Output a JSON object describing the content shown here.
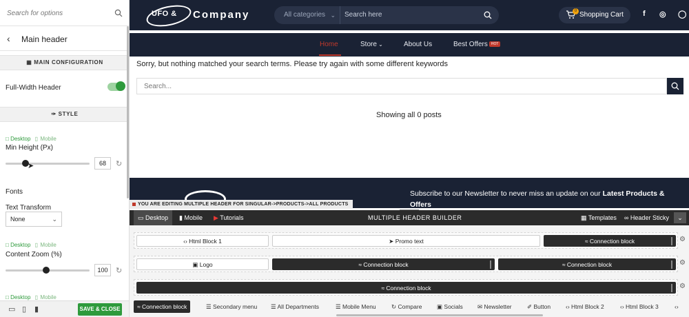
{
  "sidebar": {
    "search_placeholder": "Search for options",
    "back_title": "Main header",
    "section_main": "MAIN CONFIGURATION",
    "full_width_label": "Full-Width Header",
    "full_width_on": true,
    "section_style": "STYLE",
    "device_desktop": "Desktop",
    "device_mobile": "Mobile",
    "min_height_label": "Min Height (Px)",
    "min_height_value": "68",
    "min_height_fraction": 0.24,
    "fonts_label": "Fonts",
    "text_transform_label": "Text Transform",
    "text_transform_value": "None",
    "content_zoom_label": "Content Zoom (%)",
    "content_zoom_value": "100",
    "content_zoom_fraction": 0.48,
    "save_label": "SAVE & CLOSE"
  },
  "site": {
    "logo_text": "UFO &",
    "company": "Company",
    "category_select": "All categories",
    "search_placeholder": "Search here",
    "cart_label": "Shopping Cart",
    "cart_count": "0",
    "social": [
      "f",
      "◎",
      "◯"
    ],
    "nav": [
      "Home",
      "Store",
      "About Us",
      "Best Offers"
    ],
    "hot_badge": "HOT",
    "no_results": "Sorry, but nothing matched your search terms. Please try again with some different keywords",
    "search_input_placeholder": "Search...",
    "showing": "Showing all 0 posts",
    "newsletter_text": "Subscribe to our Newsletter to never miss an update on our ",
    "newsletter_bold": "Latest Products & Offers",
    "editing_notice": "YOU ARE EDITING MULTIPLE HEADER FOR SINGULAR->PRODUCTS->ALL PRODUCTS"
  },
  "builder": {
    "tab_desktop": "Desktop",
    "tab_mobile": "Mobile",
    "tab_tutorials": "Tutorials",
    "title": "MULTIPLE HEADER BUILDER",
    "templates": "Templates",
    "header_sticky": "Header Sticky",
    "row1": [
      "Html Block 1",
      "Promo text",
      "Connection block"
    ],
    "row2": [
      "Logo",
      "Connection block",
      "Connection block"
    ],
    "row3": [
      "Connection block"
    ],
    "elements": [
      "Connection block",
      "Secondary menu",
      "All Departments",
      "Mobile Menu",
      "Compare",
      "Socials",
      "Newsletter",
      "Button",
      "Html Block 2",
      "Html Block 3"
    ]
  },
  "colors": {
    "header_bg": "#1a2234",
    "accent_green": "#2e9a3c",
    "active_red": "#c0392b",
    "builder_dark": "#2b2b2b"
  }
}
